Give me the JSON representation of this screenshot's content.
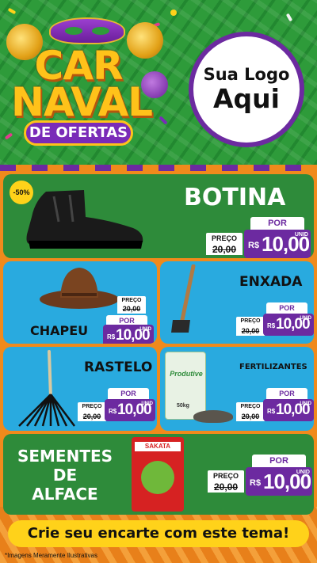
{
  "header": {
    "title_line1": "CAR",
    "title_line2": "NAVAL",
    "subtitle": "DE OFERTAS",
    "logo_line1": "Sua Logo",
    "logo_line2": "Aqui"
  },
  "colors": {
    "banner_green": "#2e9b3a",
    "card_green": "#2e8b3a",
    "card_blue": "#29aadf",
    "price_purple": "#6c2aa0",
    "cta_yellow": "#ffd21a",
    "background_orange": "#f08a1c"
  },
  "products": [
    {
      "name": "BOTINA",
      "badge": "-50%",
      "price_label": "PREÇO",
      "old_price": "20,00",
      "por": "POR",
      "currency": "R$",
      "price": "10,00",
      "unit": "UNID",
      "icon": "boot-icon"
    },
    {
      "name": "CHAPEU",
      "price_label": "PREÇO",
      "old_price": "20,00",
      "por": "POR",
      "currency": "R$",
      "price": "10,00",
      "unit": "UNID",
      "icon": "hat-icon"
    },
    {
      "name": "ENXADA",
      "price_label": "PREÇO",
      "old_price": "20,00",
      "por": "POR",
      "currency": "R$",
      "price": "10,00",
      "unit": "UNID",
      "icon": "hoe-icon"
    },
    {
      "name": "RASTELO",
      "price_label": "PREÇO",
      "old_price": "20,00",
      "por": "POR",
      "currency": "R$",
      "price": "10,00",
      "unit": "UNID",
      "icon": "rake-icon"
    },
    {
      "name": "FERTILIZANTES",
      "price_label": "PREÇO",
      "old_price": "20,00",
      "por": "POR",
      "currency": "R$",
      "price": "10,00",
      "unit": "UNID",
      "icon": "fertilizer-bag-icon",
      "bag_brand": "Produtive",
      "bag_weight": "50kg"
    },
    {
      "name_line1": "SEMENTES",
      "name_line2": "DE",
      "name_line3": "ALFACE",
      "price_label": "PREÇO",
      "old_price": "20,00",
      "por": "POR",
      "currency": "R$",
      "price": "10,00",
      "unit": "UNID",
      "icon": "seed-packet-icon",
      "packet_brand": "SAKATA"
    }
  ],
  "footer": {
    "cta": "Crie seu encarte com este tema!",
    "note": "*Imagens Meramente Ilustrativas"
  }
}
